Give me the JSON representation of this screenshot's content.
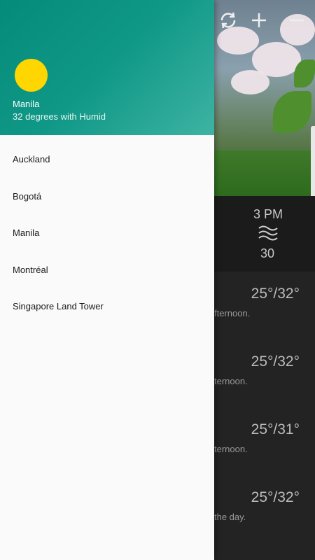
{
  "drawer": {
    "header": {
      "city": "Manila",
      "condition": "32 degrees with Humid",
      "icon": "sun-icon",
      "sun_color": "#ffd600",
      "header_color": "#109887"
    },
    "cities": [
      {
        "label": "Auckland"
      },
      {
        "label": "Bogotá"
      },
      {
        "label": "Manila"
      },
      {
        "label": "Montréal"
      },
      {
        "label": "Singapore Land Tower"
      }
    ]
  },
  "background_app": {
    "toolbar_icons": [
      "refresh-icon",
      "add-icon",
      "remove-icon"
    ],
    "hourly": {
      "time": "3 PM",
      "icon": "haze-icon",
      "temp": "30"
    },
    "daily": [
      {
        "temp": "25°/32°",
        "desc": "fternoon."
      },
      {
        "temp": "25°/32°",
        "desc": "ternoon."
      },
      {
        "temp": "25°/31°",
        "desc": "ternoon."
      },
      {
        "temp": "25°/32°",
        "desc": "the day."
      }
    ]
  }
}
